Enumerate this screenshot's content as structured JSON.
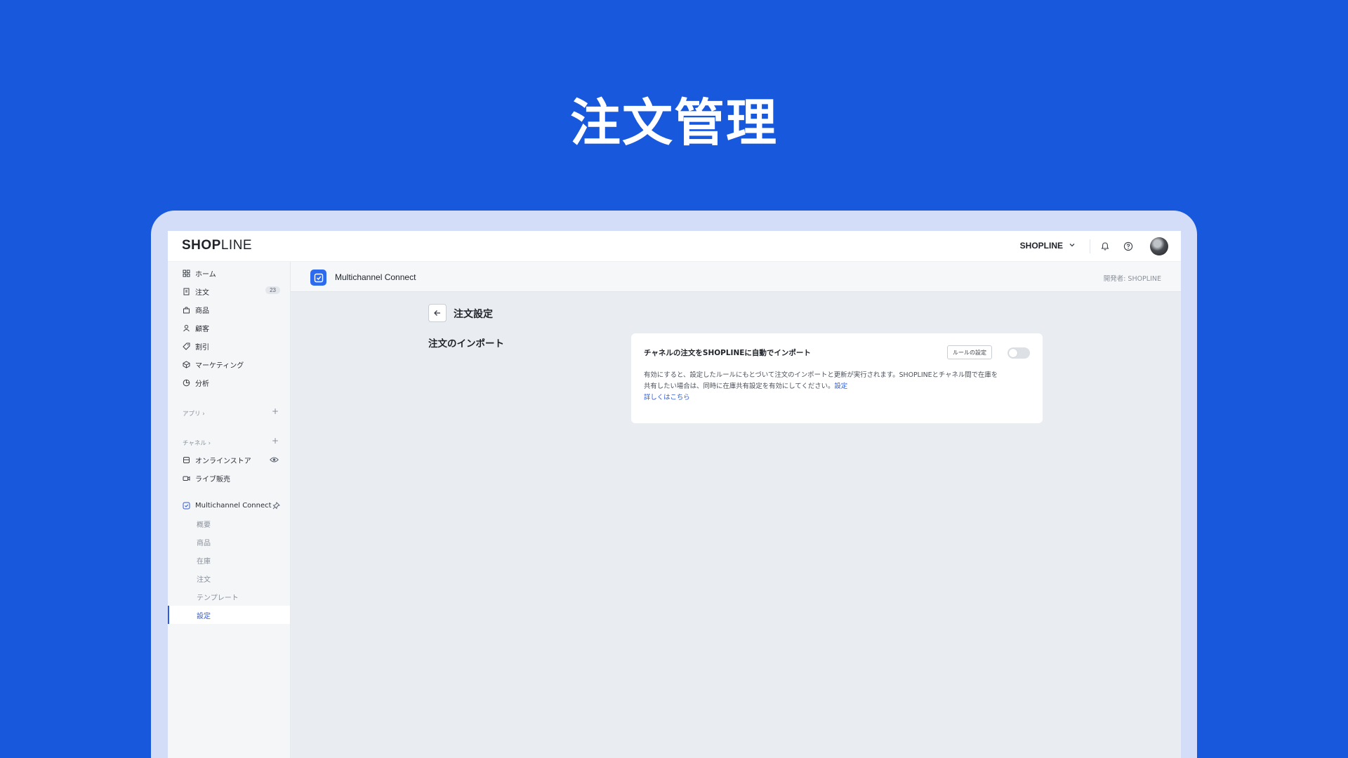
{
  "hero": {
    "title": "注文管理"
  },
  "topbar": {
    "logo_bold": "SHOP",
    "logo_thin": "LINE",
    "store_name": "SHOPLINE"
  },
  "sidebar": {
    "items": [
      {
        "label": "ホーム",
        "icon": "home-grid-icon"
      },
      {
        "label": "注文",
        "icon": "order-doc-icon",
        "badge": "23"
      },
      {
        "label": "商品",
        "icon": "bag-icon"
      },
      {
        "label": "顧客",
        "icon": "person-icon"
      },
      {
        "label": "割引",
        "icon": "tag-icon"
      },
      {
        "label": "マーケティング",
        "icon": "marketing-icon"
      },
      {
        "label": "分析",
        "icon": "analytics-icon"
      }
    ],
    "apps_label": "アプリ ›",
    "channels_label": "チャネル ›",
    "channels": [
      {
        "label": "オンラインストア",
        "icon": "store-icon"
      },
      {
        "label": "ライブ販売",
        "icon": "video-icon"
      }
    ],
    "app_section": {
      "label": "Multichannel Connect",
      "sub_items": [
        "概要",
        "商品",
        "在庫",
        "注文",
        "テンプレート",
        "設定"
      ],
      "active": "設定"
    }
  },
  "app_header": {
    "name": "Multichannel Connect",
    "developer": "開発者: SHOPLINE"
  },
  "page": {
    "title": "注文設定",
    "section_title": "注文のインポート",
    "card": {
      "title": "チャネルの注文をSHOPLINEに自動でインポート",
      "rule_button": "ルールの設定",
      "toggle_on": false,
      "desc_line1": "有効にすると、設定したルールにもとづいて注文のインポートと更新が実行されます。SHOPLINEとチャネル間で在庫を",
      "desc_line2": "共有したい場合は、同時に在庫共有設定を有効にしてください。",
      "settings_link": "設定",
      "details_link": "詳しくはこちら"
    }
  },
  "colors": {
    "background": "#1858DC",
    "accent": "#2E5BDB",
    "app_icon": "#2D6BEE"
  }
}
